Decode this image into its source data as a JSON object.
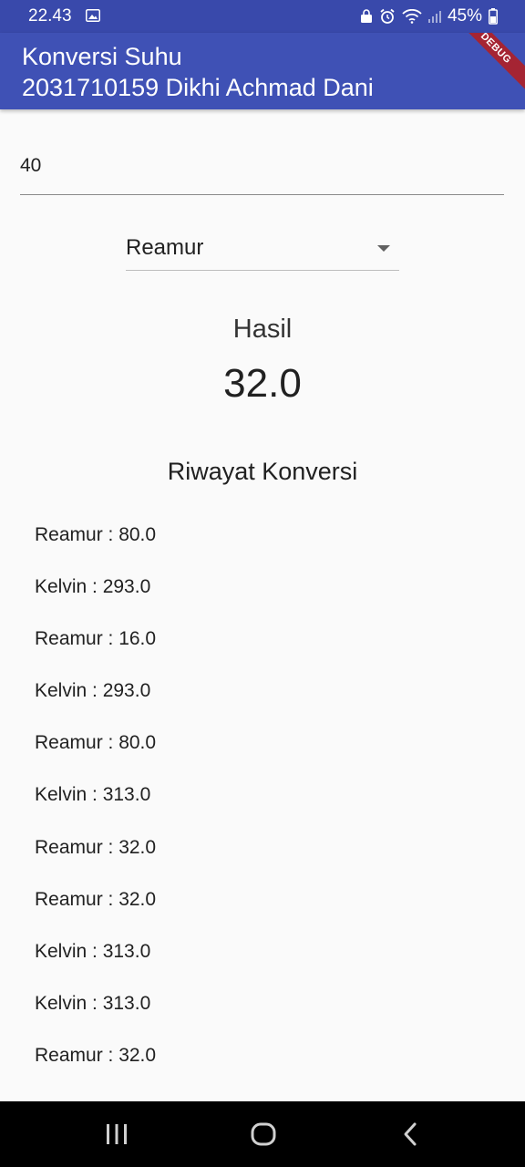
{
  "status_bar": {
    "time": "22.43",
    "battery": "45%"
  },
  "app_bar": {
    "title_line1": "Konversi Suhu",
    "title_line2": "2031710159 Dikhi Achmad Dani",
    "debug_banner": "DEBUG"
  },
  "input": {
    "value": "40"
  },
  "dropdown": {
    "selected": "Reamur"
  },
  "result": {
    "label": "Hasil",
    "value": "32.0"
  },
  "history": {
    "title": "Riwayat Konversi",
    "items": [
      "Reamur : 80.0",
      "Kelvin : 293.0",
      "Reamur : 16.0",
      "Kelvin : 293.0",
      "Reamur : 80.0",
      "Kelvin : 313.0",
      "Reamur : 32.0",
      "Reamur : 32.0",
      "Kelvin : 313.0",
      "Kelvin : 313.0",
      "Reamur : 32.0"
    ]
  },
  "nav": {
    "icons": [
      "recent-apps-icon",
      "home-icon",
      "back-icon"
    ]
  },
  "colors": {
    "app_bar": "#3f51b5",
    "status_bar": "#3949ab",
    "background": "#fafafa"
  }
}
